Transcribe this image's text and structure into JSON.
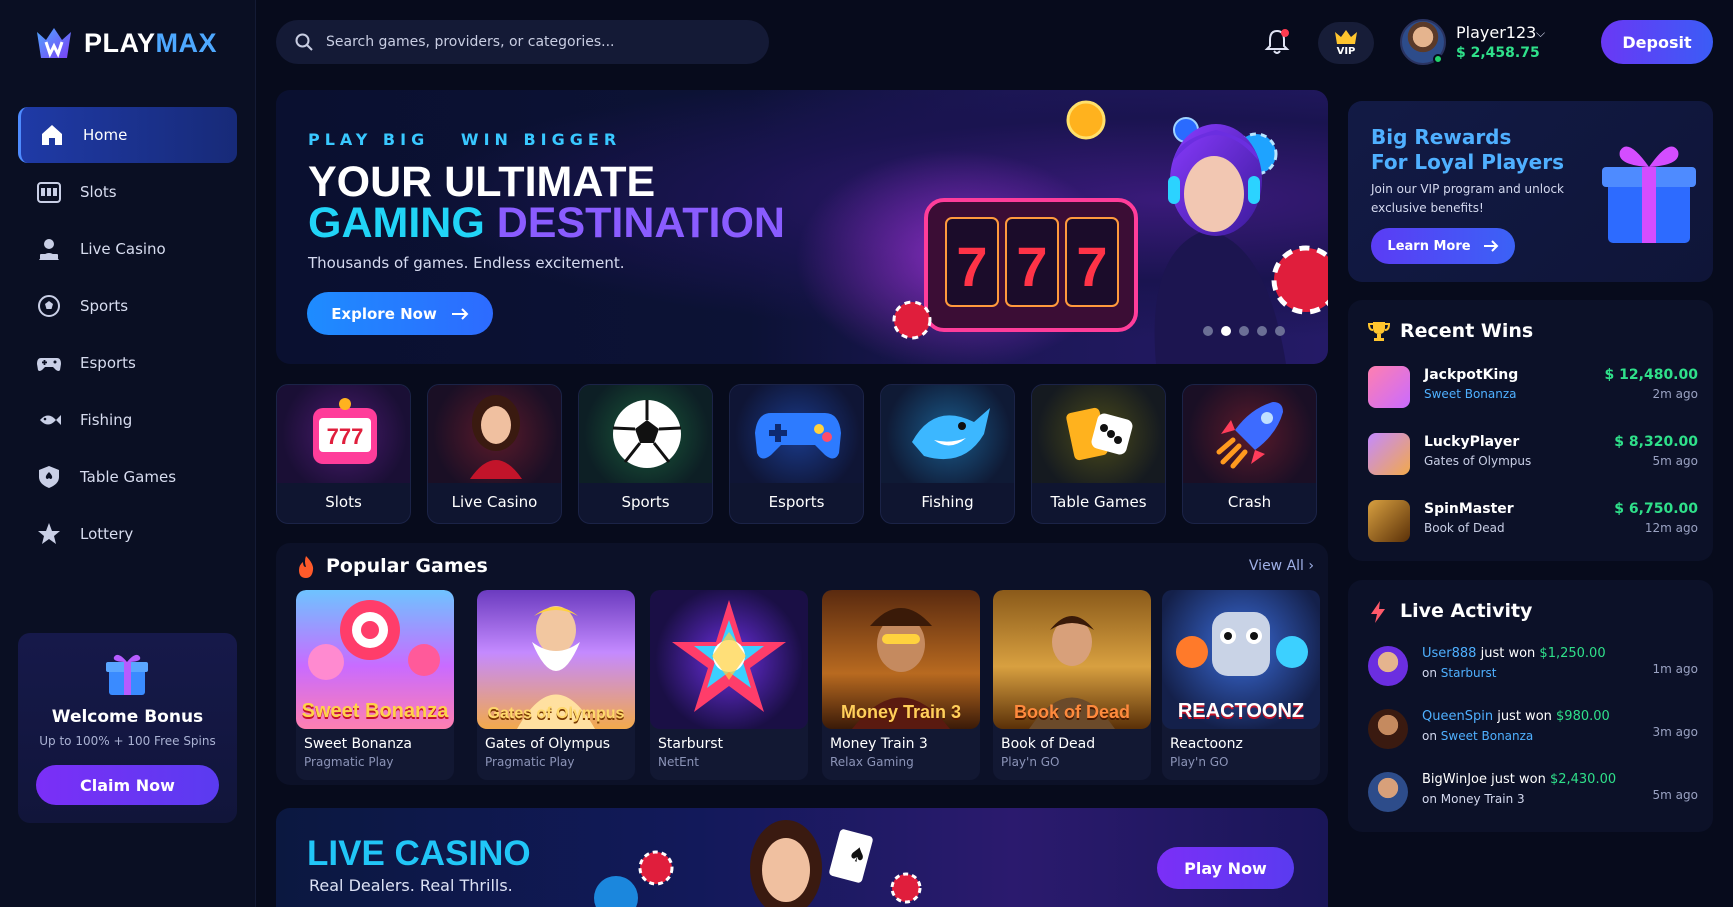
{
  "brand": {
    "play": "PLAY",
    "max": "MAX"
  },
  "search": {
    "placeholder": "Search games, providers, or categories..."
  },
  "header": {
    "vip_label": "VIP",
    "username": "Player123",
    "balance": "$ 2,458.75",
    "deposit_label": "Deposit"
  },
  "sidebar": {
    "items": [
      {
        "label": "Home",
        "icon": "home-icon",
        "active": true
      },
      {
        "label": "Slots",
        "icon": "slot-machine-icon"
      },
      {
        "label": "Live Casino",
        "icon": "dealer-icon"
      },
      {
        "label": "Sports",
        "icon": "soccer-ball-icon"
      },
      {
        "label": "Esports",
        "icon": "gamepad-icon"
      },
      {
        "label": "Fishing",
        "icon": "fish-icon"
      },
      {
        "label": "Table Games",
        "icon": "shield-spade-icon"
      },
      {
        "label": "Lottery",
        "icon": "star-icon"
      }
    ],
    "bonus": {
      "title": "Welcome Bonus",
      "subtitle": "Up to 100% + 100 Free Spins",
      "button": "Claim Now"
    }
  },
  "hero": {
    "tagline": "PLAY BIG   WIN BIGGER",
    "line1": "YOUR ULTIMATE",
    "line2a": "GAMING",
    "line2b": "DESTINATION",
    "subtitle": "Thousands of games. Endless excitement.",
    "button": "Explore Now",
    "slide_count": 5,
    "active_slide": 0
  },
  "categories": [
    {
      "label": "Slots",
      "icon": "slot-machine-icon"
    },
    {
      "label": "Live Casino",
      "icon": "dealer-icon"
    },
    {
      "label": "Sports",
      "icon": "soccer-ball-icon"
    },
    {
      "label": "Esports",
      "icon": "gamepad-icon"
    },
    {
      "label": "Fishing",
      "icon": "shark-icon"
    },
    {
      "label": "Table Games",
      "icon": "cards-dice-icon"
    },
    {
      "label": "Crash",
      "icon": "rocket-icon"
    }
  ],
  "popular": {
    "title": "Popular Games",
    "view_all": "View All",
    "games": [
      {
        "name": "Sweet Bonanza",
        "provider": "Pragmatic Play",
        "art_text": "Sweet Bonanza"
      },
      {
        "name": "Gates of Olympus",
        "provider": "Pragmatic Play",
        "art_text": "Gates of Olympus"
      },
      {
        "name": "Starburst",
        "provider": "NetEnt",
        "art_text": ""
      },
      {
        "name": "Money Train 3",
        "provider": "Relax Gaming",
        "art_text": "Money Train 3"
      },
      {
        "name": "Book of Dead",
        "provider": "Play'n GO",
        "art_text": "Book of Dead"
      },
      {
        "name": "Reactoonz",
        "provider": "Play'n GO",
        "art_text": "REACTOONZ"
      }
    ]
  },
  "live_casino": {
    "title": "LIVE CASINO",
    "subtitle": "Real Dealers. Real Thrills.",
    "button": "Play Now"
  },
  "rewards": {
    "title1": "Big Rewards",
    "title2": "For Loyal Players",
    "subtitle": "Join our VIP program and unlock exclusive benefits!",
    "button": "Learn More"
  },
  "recent_wins": {
    "title": "Recent Wins",
    "items": [
      {
        "user": "JackpotKing",
        "game": "Sweet Bonanza",
        "amount": "$ 12,480.00",
        "time": "2m ago"
      },
      {
        "user": "LuckyPlayer",
        "game": "Gates of Olympus",
        "amount": "$ 8,320.00",
        "time": "5m ago"
      },
      {
        "user": "SpinMaster",
        "game": "Book of Dead",
        "amount": "$ 6,750.00",
        "time": "12m ago"
      }
    ]
  },
  "live_activity": {
    "title": "Live Activity",
    "items": [
      {
        "user": "User888",
        "mid": "just won",
        "amount": "$1,250.00",
        "on": "on",
        "game": "Starburst",
        "time": "1m ago"
      },
      {
        "user": "QueenSpin",
        "mid": "just won",
        "amount": "$980.00",
        "on": "on",
        "game": "Sweet Bonanza",
        "time": "3m ago"
      },
      {
        "user": "BigWinJoe",
        "mid": "just won",
        "amount": "$2,430.00",
        "on": "on",
        "game": "Money Train 3",
        "time": "5m ago"
      }
    ]
  },
  "colors": {
    "accent": "#4fb0ff",
    "win_green": "#2fe08a",
    "cyan": "#21d4f7",
    "purple": "#8a5cff",
    "background": "#070b1c"
  }
}
